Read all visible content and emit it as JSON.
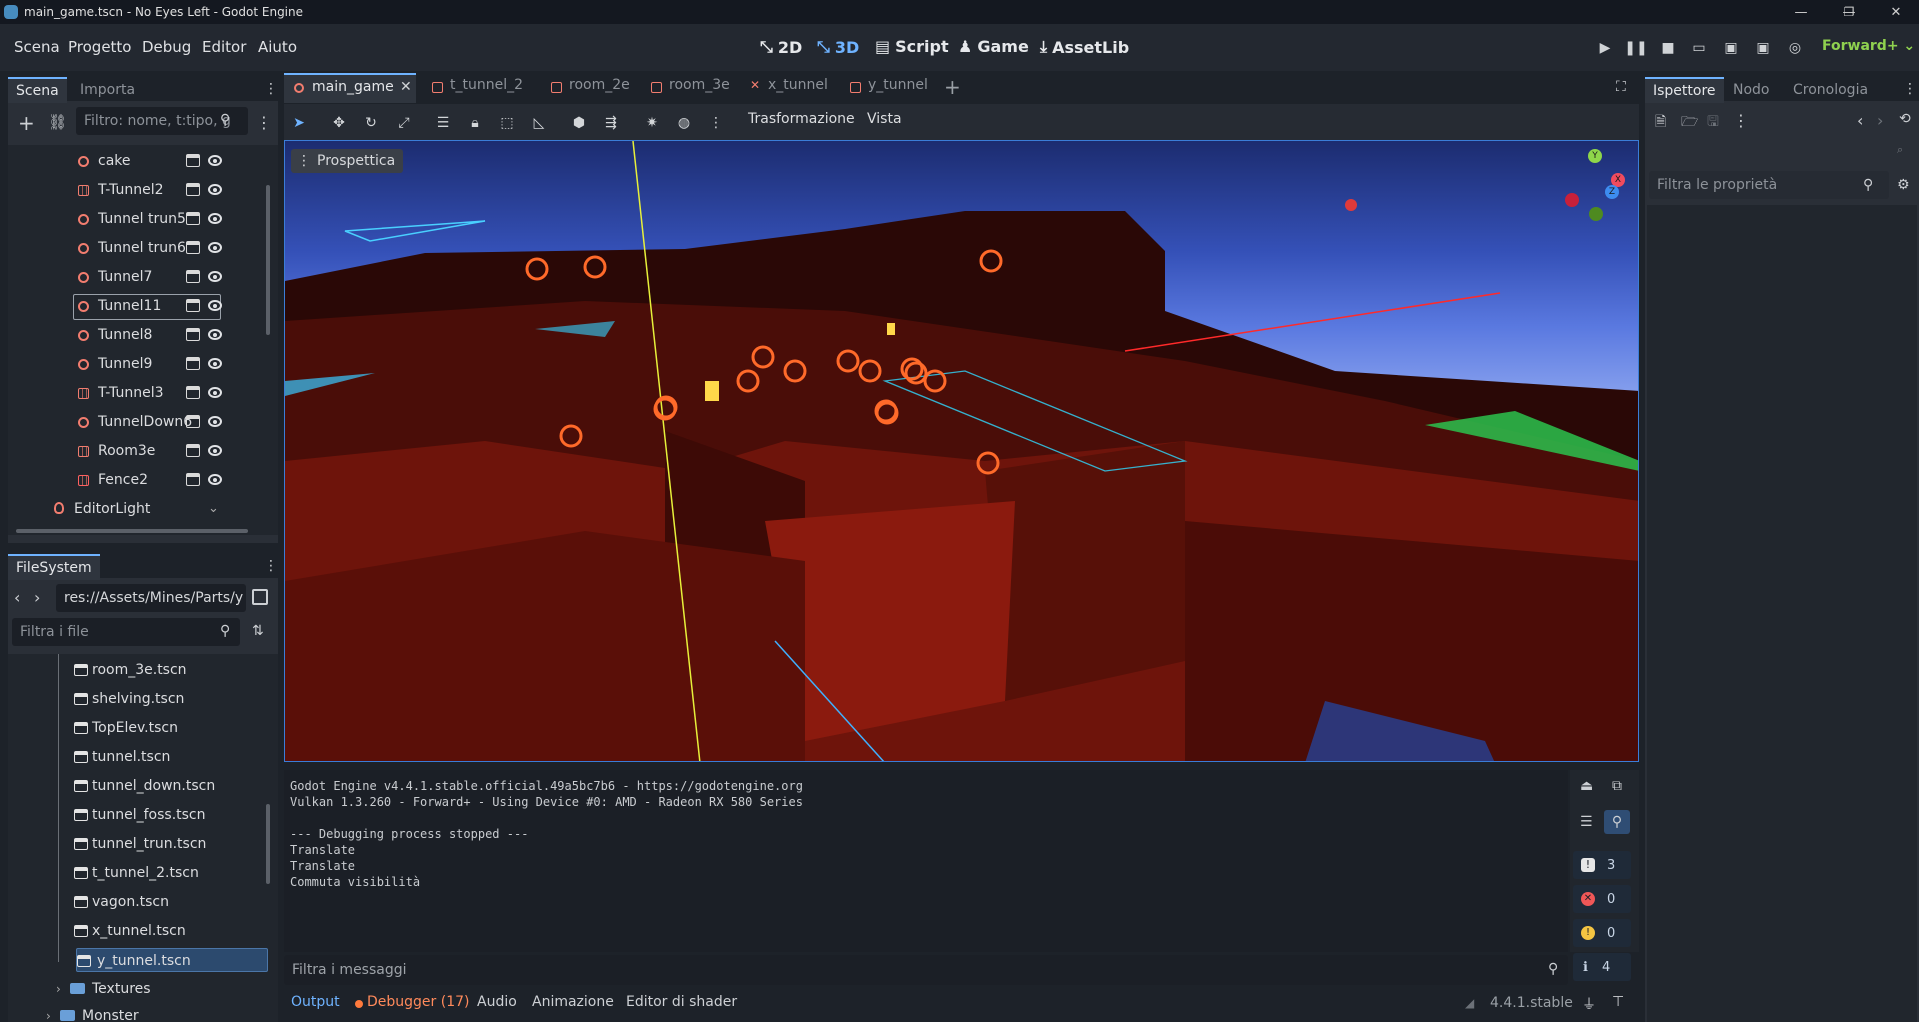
{
  "window": {
    "title": "main_game.tscn - No Eyes Left - Godot Engine"
  },
  "menu": [
    "Scena",
    "Progetto",
    "Debug",
    "Editor",
    "Aiuto"
  ],
  "workspaces": [
    {
      "label": "2D",
      "active": false
    },
    {
      "label": "3D",
      "active": true
    },
    {
      "label": "Script",
      "active": false
    },
    {
      "label": "Game",
      "active": false
    },
    {
      "label": "AssetLib",
      "active": false
    }
  ],
  "renderer": "Forward+",
  "scene_dock": {
    "tabs": [
      "Scena",
      "Importa"
    ],
    "filter_placeholder": "Filtro: nome, t:tipo, g",
    "nodes": [
      {
        "name": "cake",
        "icon": "node3d"
      },
      {
        "name": "T-Tunnel2",
        "icon": "instance"
      },
      {
        "name": "Tunnel trun5",
        "icon": "node3d"
      },
      {
        "name": "Tunnel trun6",
        "icon": "node3d"
      },
      {
        "name": "Tunnel7",
        "icon": "node3d"
      },
      {
        "name": "Tunnel11",
        "icon": "node3d"
      },
      {
        "name": "Tunnel8",
        "icon": "node3d"
      },
      {
        "name": "Tunnel9",
        "icon": "node3d"
      },
      {
        "name": "T-Tunnel3",
        "icon": "instance"
      },
      {
        "name": "TunnelDown6",
        "icon": "node3d"
      },
      {
        "name": "Room3e",
        "icon": "instance"
      },
      {
        "name": "Fence2",
        "icon": "instance-red"
      }
    ],
    "editor_light": "EditorLight"
  },
  "filesystem": {
    "tab": "FileSystem",
    "path": "res://Assets/Mines/Parts/y",
    "filter_placeholder": "Filtra i file",
    "files": [
      "room_3e.tscn",
      "shelving.tscn",
      "TopElev.tscn",
      "tunnel.tscn",
      "tunnel_down.tscn",
      "tunnel_foss.tscn",
      "tunnel_trun.tscn",
      "t_tunnel_2.tscn",
      "vagon.tscn",
      "x_tunnel.tscn",
      "y_tunnel.tscn"
    ],
    "folders": [
      "Textures",
      "Monster"
    ]
  },
  "editor_tabs": [
    "main_game",
    "t_tunnel_2",
    "room_2e",
    "room_3e",
    "x_tunnel",
    "y_tunnel"
  ],
  "toolbar": {
    "transform": "Trasformazione",
    "view": "Vista"
  },
  "viewport": {
    "perspective_label": "Prospettica",
    "gizmo_axes": [
      "Y",
      "X",
      "Z"
    ]
  },
  "inspector": {
    "tabs": [
      "Ispettore",
      "Nodo",
      "Cronologia"
    ],
    "filter_placeholder": "Filtra le proprietà"
  },
  "output": {
    "lines": [
      "Godot Engine v4.4.1.stable.official.49a5bc7b6 - https://godotengine.org",
      "Vulkan 1.3.260 - Forward+ - Using Device #0: AMD - Radeon RX 580 Series",
      "",
      "--- Debugging process stopped ---",
      "Translate",
      "Translate",
      "Commuta visibilità"
    ],
    "filter_placeholder": "Filtra i messaggi",
    "counts": {
      "errors": "3",
      "error_x": "0",
      "warnings": "0",
      "info": "4"
    }
  },
  "bottom_tabs": [
    "Output",
    "Debugger (17)",
    "Audio",
    "Animazione",
    "Editor di shader"
  ],
  "version": "4.4.1.stable",
  "colors": {
    "accent": "#6fb3ff",
    "node_red": "#f27d6f",
    "renderer_green": "#8fd14f"
  }
}
